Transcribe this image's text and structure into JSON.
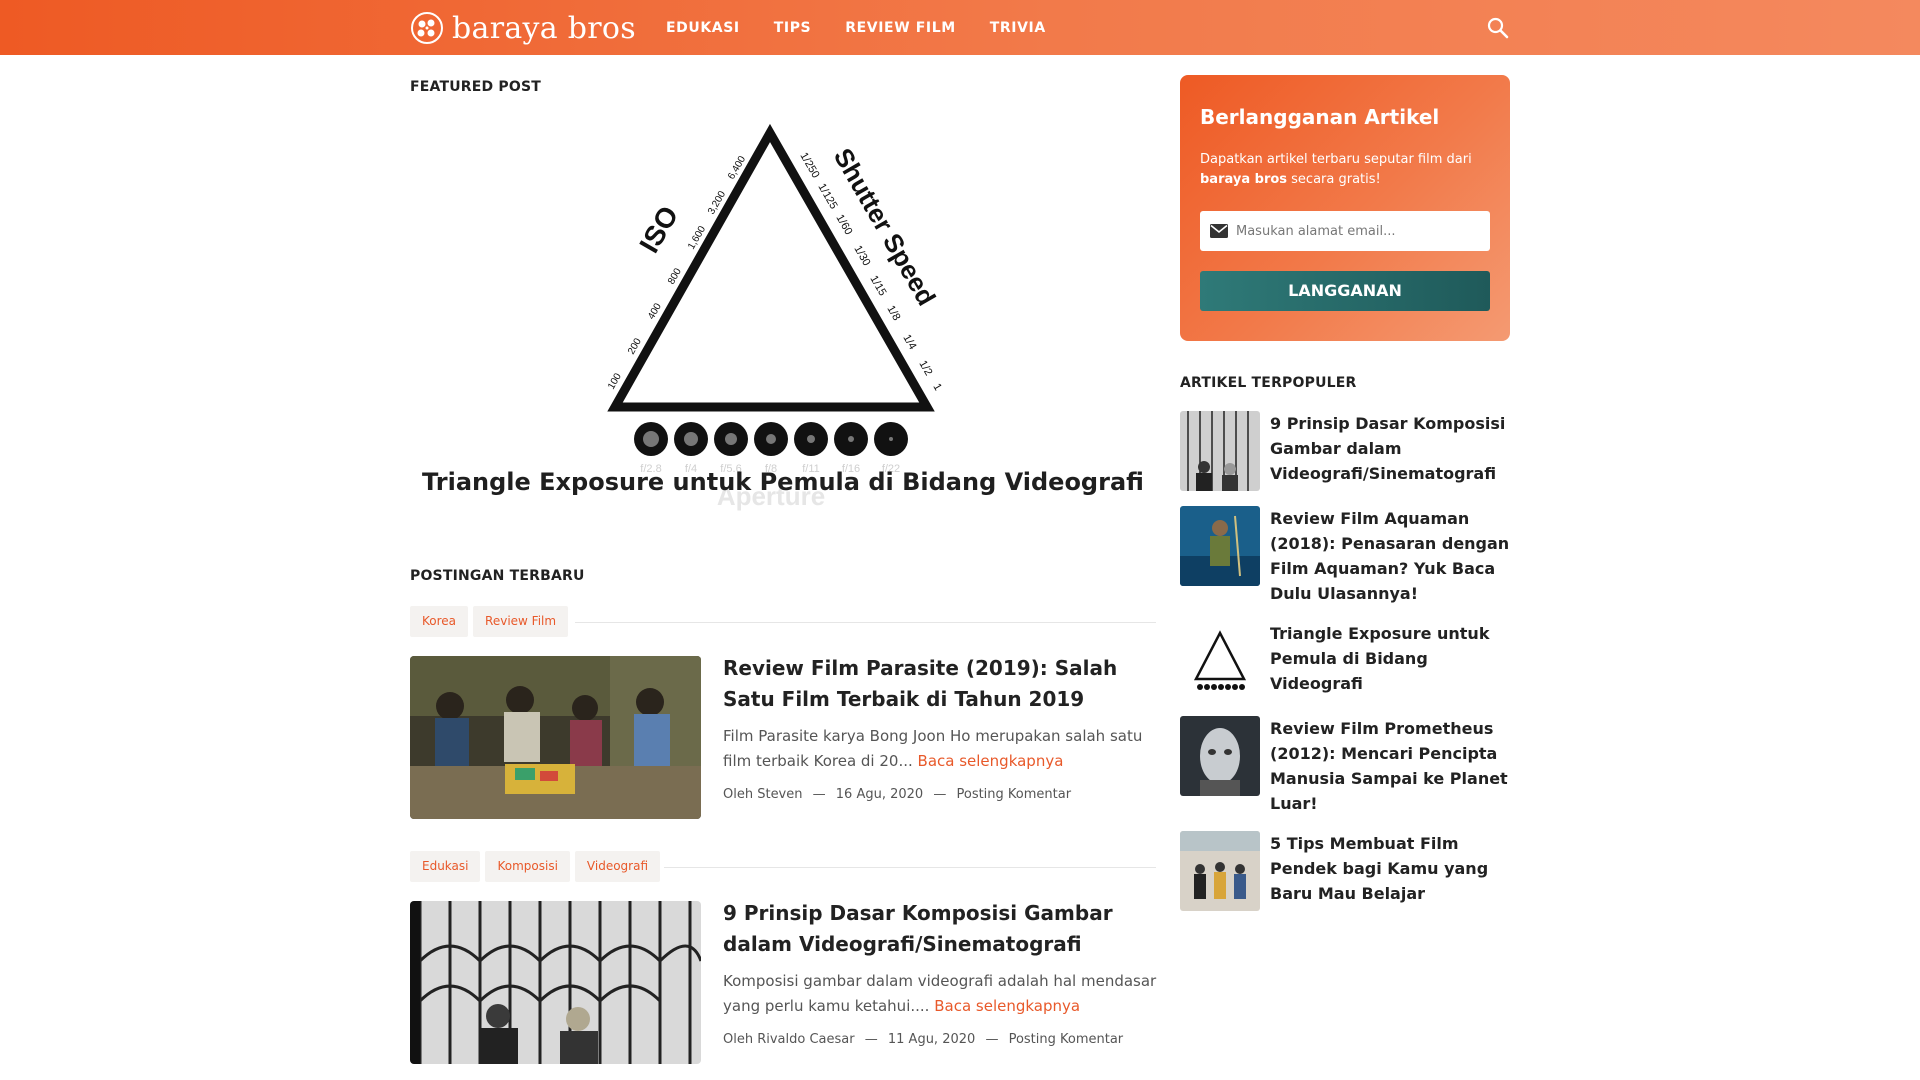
{
  "header": {
    "logo_text": "baraya bros",
    "nav": [
      "EDUKASI",
      "TIPS",
      "REVIEW FILM",
      "TRIVIA"
    ]
  },
  "featured": {
    "label": "FEATURED POST",
    "title": "Triangle Exposure untuk Pemula di Bidang Videografi",
    "diagram": {
      "iso_label": "ISO",
      "shutter_label": "Shutter Speed",
      "aperture_label": "Aperture",
      "iso_values": [
        "100",
        "200",
        "400",
        "800",
        "1,600",
        "3,200",
        "6,400"
      ],
      "shutter_values": [
        "1/250",
        "1/125",
        "1/60",
        "1/30",
        "1/15",
        "1/8",
        "1/4",
        "1/2",
        "1"
      ],
      "aperture_values": [
        "f/2.8",
        "f/4",
        "f/5.6",
        "f/8",
        "f/11",
        "f/16",
        "f/22"
      ]
    }
  },
  "recent": {
    "label": "POSTINGAN TERBARU",
    "read_more": "Baca selengkapnya",
    "posts": [
      {
        "tags": [
          "Korea",
          "Review Film"
        ],
        "title": "Review Film Parasite (2019): Salah Satu Film Terbaik di Tahun 2019",
        "excerpt": "Film Parasite karya Bong Joon Ho merupakan salah satu film terbaik Korea di 20...",
        "author": "Oleh Steven",
        "date": "16 Agu, 2020",
        "comments": "Posting Komentar"
      },
      {
        "tags": [
          "Edukasi",
          "Komposisi",
          "Videografi"
        ],
        "title": "9 Prinsip Dasar Komposisi Gambar dalam Videografi/Sinematografi",
        "excerpt": "Komposisi gambar dalam videografi adalah hal mendasar yang perlu kamu ketahui....",
        "author": "Oleh Rivaldo Caesar",
        "date": "11 Agu, 2020",
        "comments": "Posting Komentar"
      }
    ],
    "separator": "—"
  },
  "subscribe": {
    "title": "Berlangganan Artikel",
    "desc_prefix": "Dapatkan artikel terbaru seputar film dari ",
    "desc_brand": "baraya bros",
    "desc_suffix": " secara gratis!",
    "placeholder": "Masukan alamat email...",
    "button": "LANGGANAN"
  },
  "popular": {
    "label": "ARTIKEL TERPOPULER",
    "items": [
      "9 Prinsip Dasar Komposisi Gambar dalam Videografi/Sinematografi",
      "Review Film Aquaman (2018): Penasaran dengan Film Aquaman? Yuk Baca Dulu Ulasannya!",
      "Triangle Exposure untuk Pemula di Bidang Videografi",
      "Review Film Prometheus (2012): Mencari Pencipta Manusia Sampai ke Planet Luar!",
      "5 Tips Membuat Film Pendek bagi Kamu yang Baru Mau Belajar"
    ]
  }
}
